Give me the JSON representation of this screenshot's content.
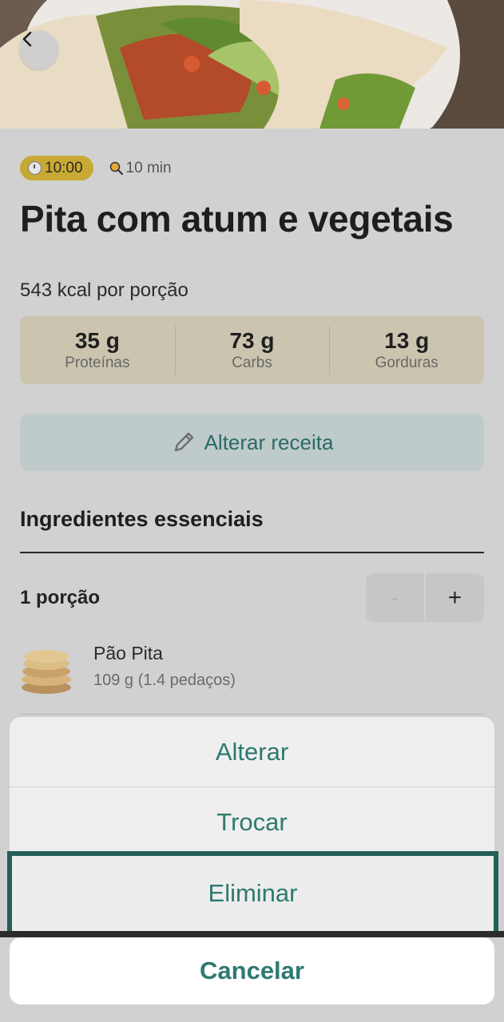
{
  "header": {
    "back_icon": "chevron-left-icon"
  },
  "recipe": {
    "timer": "10:00",
    "duration": "10 min",
    "title": "Pita com atum e vegetais",
    "kcal": "543 kcal por porção",
    "macros": [
      {
        "value": "35 g",
        "label": "Proteínas"
      },
      {
        "value": "73 g",
        "label": "Carbs"
      },
      {
        "value": "13 g",
        "label": "Gorduras"
      }
    ],
    "edit_label": "Alterar receita"
  },
  "ingredients": {
    "title": "Ingredientes essenciais",
    "portion_label": "1 porção",
    "minus": "-",
    "plus": "+",
    "items": [
      {
        "name": "Pão Pita",
        "qty": "109 g (1.4 pedaços)",
        "icon": "pita-bread-image"
      }
    ]
  },
  "action_sheet": {
    "items": [
      "Alterar",
      "Trocar",
      "Eliminar"
    ],
    "cancel": "Cancelar"
  },
  "colors": {
    "accent": "#2e7a6f",
    "badge": "#c8a933",
    "highlight_border": "#245f59"
  }
}
